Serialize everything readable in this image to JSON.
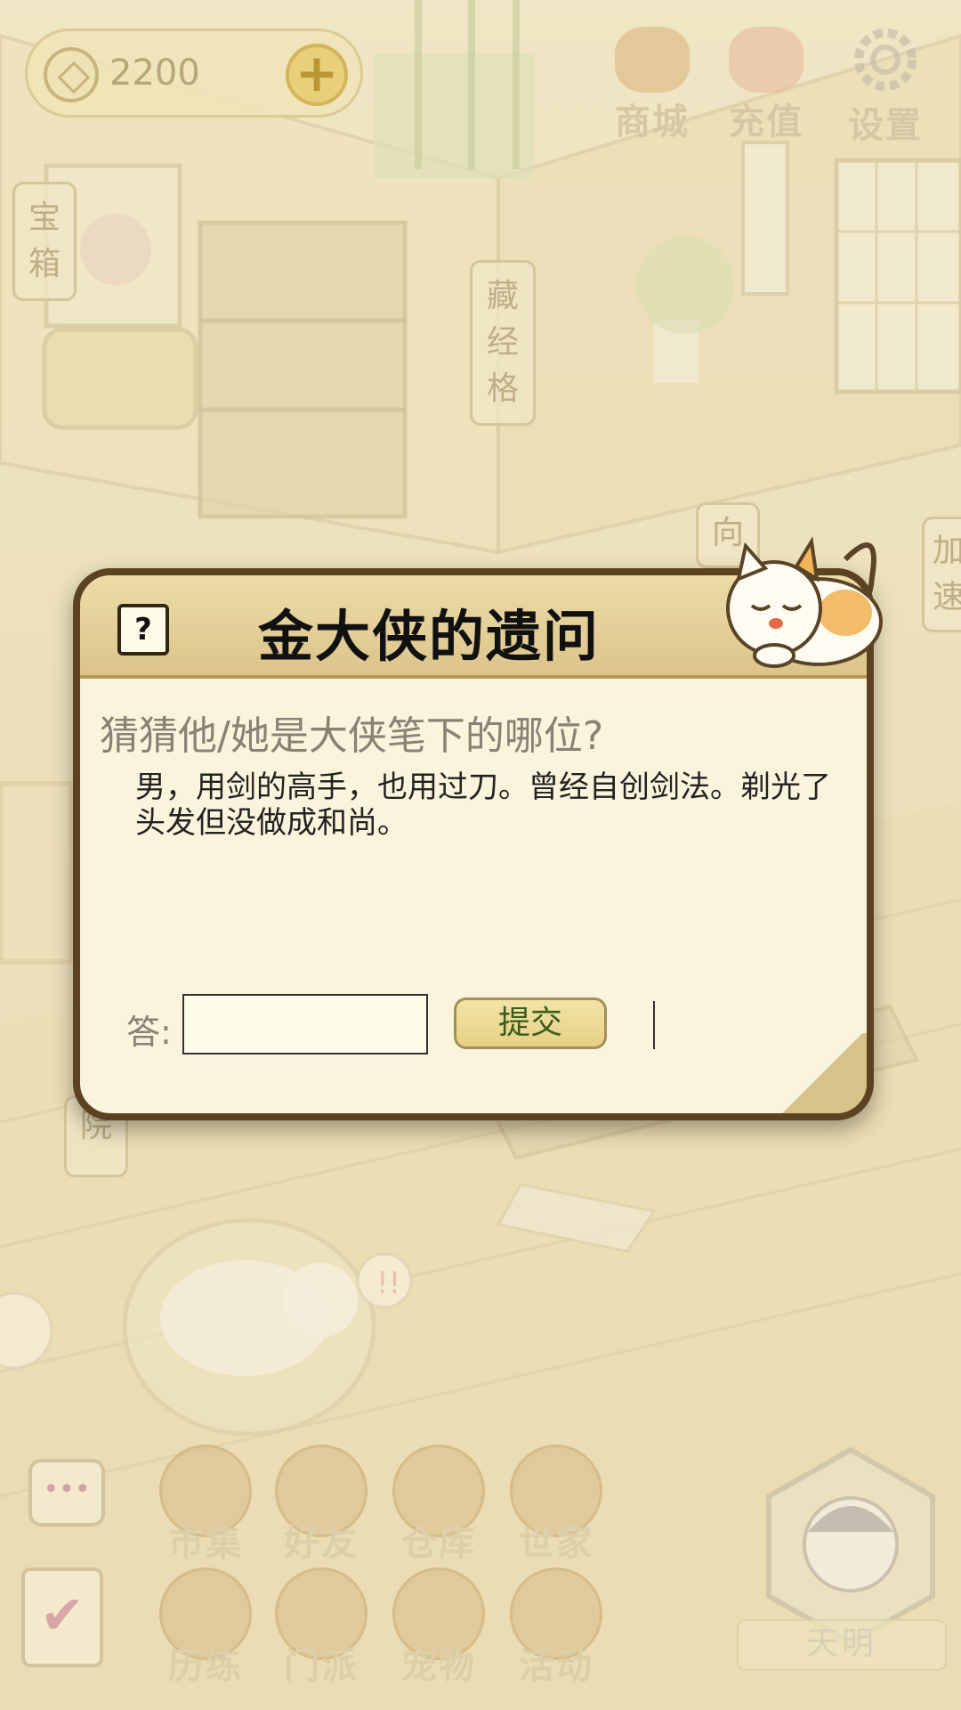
{
  "hud": {
    "coins": "2200",
    "top_buttons": [
      {
        "label": "商城",
        "icon": "shop-bag-icon"
      },
      {
        "label": "充值",
        "icon": "recharge-icon"
      },
      {
        "label": "设置",
        "icon": "gear-icon"
      }
    ]
  },
  "scene_tags": {
    "treasure": "宝箱",
    "library": "藏经格",
    "edge_right_top": "加",
    "edge_right_bottom": "速",
    "back_wall": "向",
    "lower_left": "院"
  },
  "dialog": {
    "help": "?",
    "title": "金大侠的遗问",
    "question": "猜猜他/她是大侠笔下的哪位?",
    "clue": "男，用剑的高手，也用过刀。曾经自创剑法。剃光了头发但没做成和尚。",
    "answer_label": "答:",
    "answer_value": "",
    "submit": "提交"
  },
  "bottom_menu": {
    "row1": [
      "市集",
      "好友",
      "仓库",
      "世家"
    ],
    "row2": [
      "历练",
      "门派",
      "宠物",
      "活动"
    ],
    "chat": "•••",
    "task": "✔",
    "dawn": "天明"
  },
  "colors": {
    "dialog_border": "#5d4221",
    "dialog_bg": "#fbf4dc",
    "header_bg": "#dcc48a",
    "submit_text": "#3a5b1c"
  }
}
